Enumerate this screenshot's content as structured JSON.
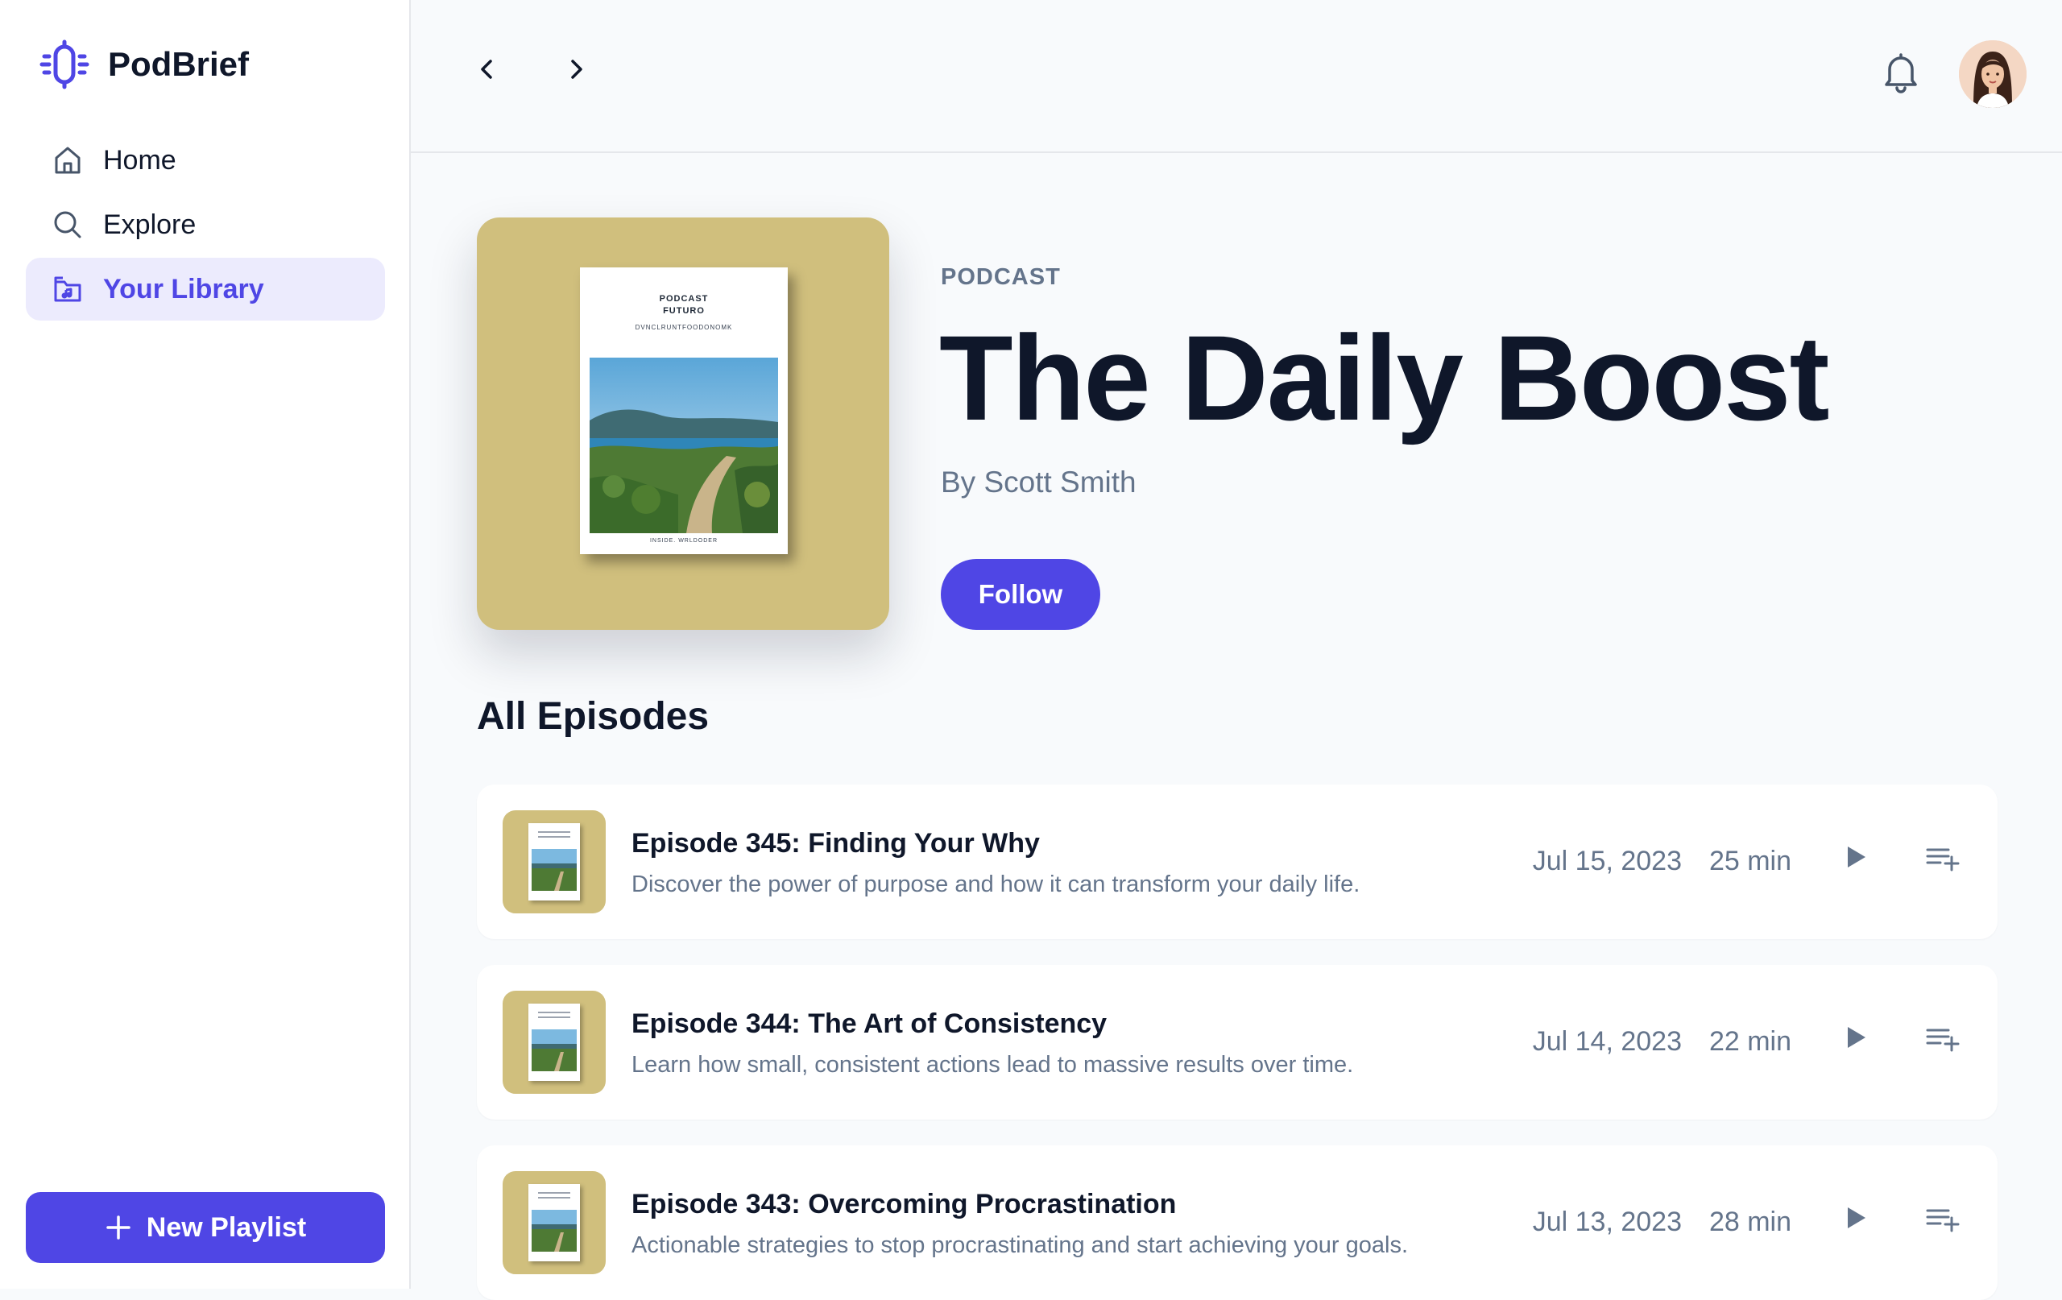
{
  "app": {
    "name": "PodBrief"
  },
  "sidebar": {
    "items": [
      {
        "label": "Home",
        "icon": "home-icon",
        "active": false
      },
      {
        "label": "Explore",
        "icon": "search-icon",
        "active": false
      },
      {
        "label": "Your Library",
        "icon": "library-icon",
        "active": true
      }
    ],
    "new_playlist_label": "New Playlist"
  },
  "header": {
    "back_icon": "chevron-left-icon",
    "forward_icon": "chevron-right-icon",
    "notification_icon": "bell-icon",
    "avatar_icon": "user-avatar"
  },
  "podcast": {
    "eyebrow": "PODCAST",
    "title": "The Daily Boost",
    "author": "By Scott Smith",
    "follow_label": "Follow",
    "cover": {
      "line1": "PODCAST",
      "line2": "FUTURO",
      "subtitle": "DVNCLRUNTFOODONOMK",
      "footer": "INSIDE. WRLDODER"
    }
  },
  "episodes_section": {
    "title": "All Episodes"
  },
  "episodes": [
    {
      "title": "Episode 345: Finding Your Why",
      "description": "Discover the power of purpose and how it can transform your daily life.",
      "date": "Jul 15, 2023",
      "duration": "25 min"
    },
    {
      "title": "Episode 344: The Art of Consistency",
      "description": "Learn how small, consistent actions lead to massive results over time.",
      "date": "Jul 14, 2023",
      "duration": "22 min"
    },
    {
      "title": "Episode 343: Overcoming Procrastination",
      "description": "Actionable strategies to stop procrastinating and start achieving your goals.",
      "date": "Jul 13, 2023",
      "duration": "28 min"
    }
  ],
  "colors": {
    "accent": "#4f46e5",
    "accent_soft": "#ecebfd",
    "cover": "#d0bf7d",
    "text": "#0f172a",
    "muted": "#64748b",
    "background": "#f8fafc"
  }
}
